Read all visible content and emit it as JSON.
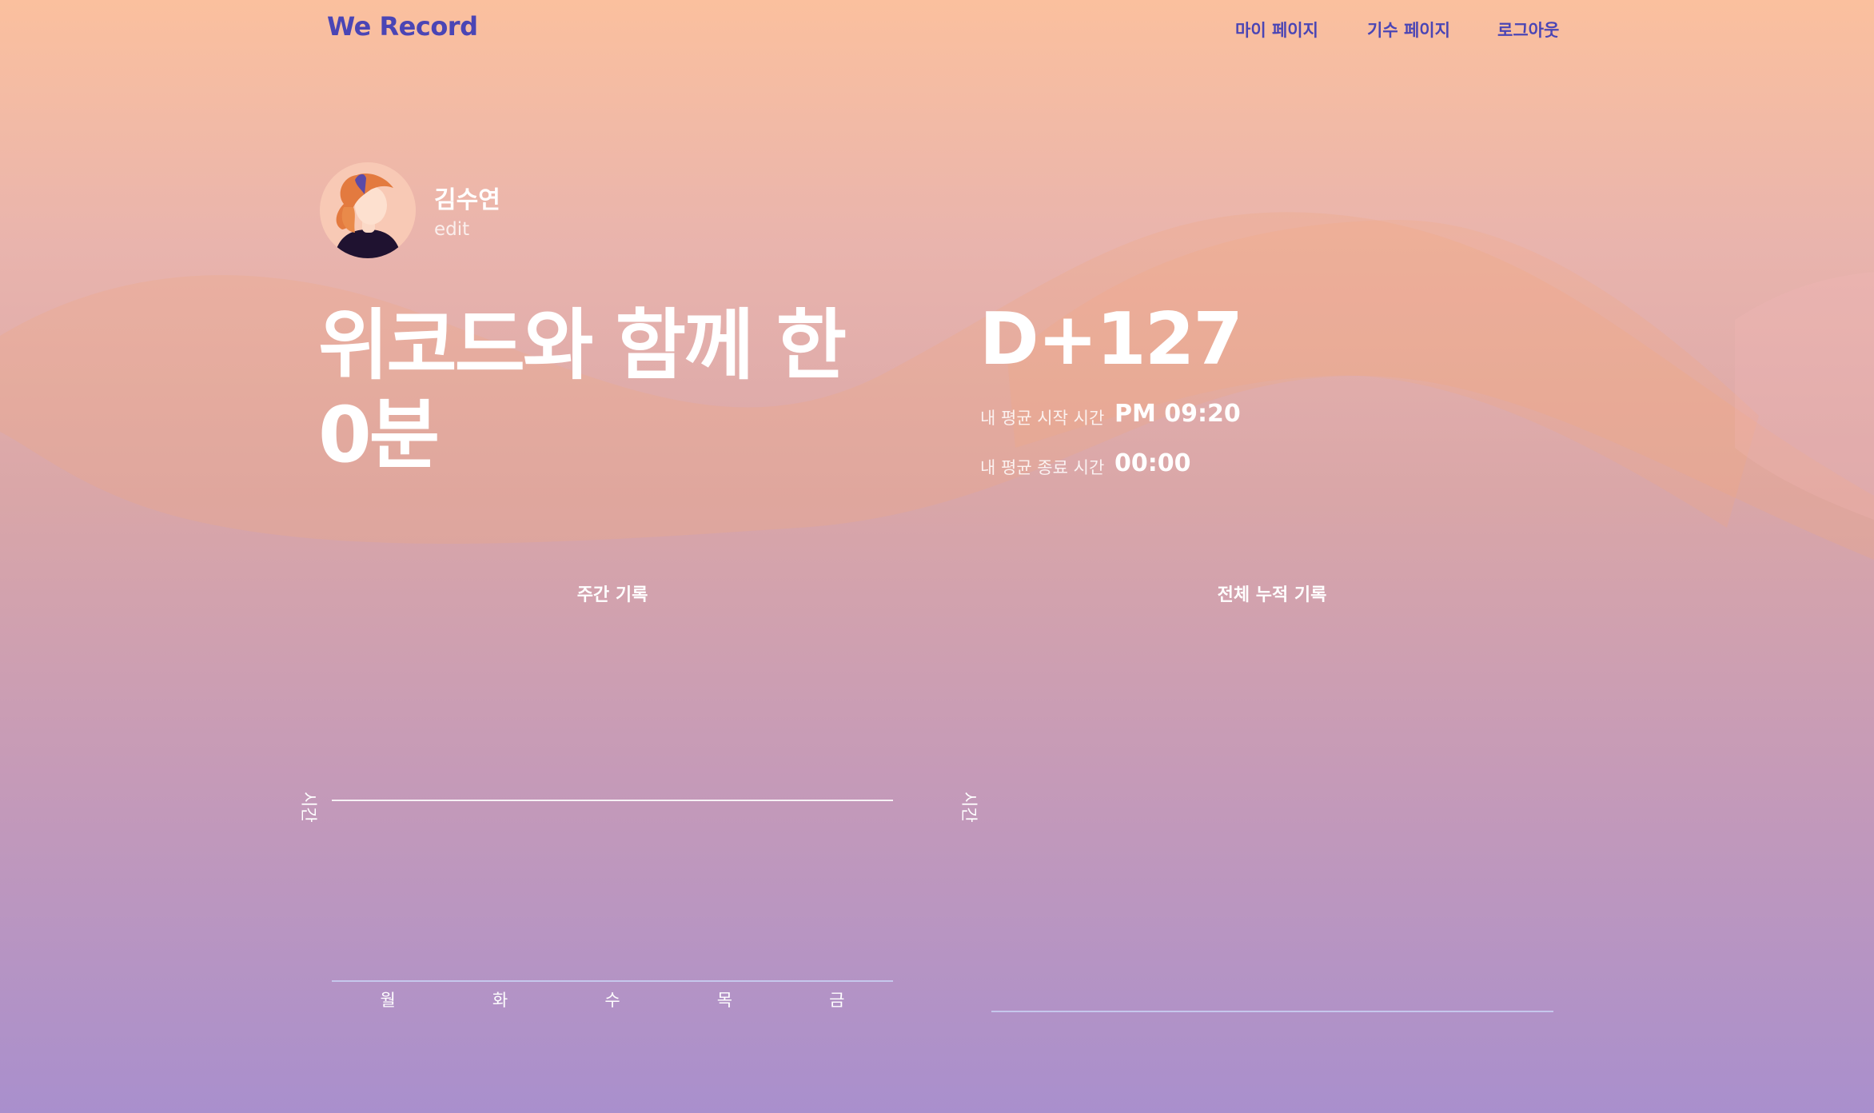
{
  "header": {
    "brand": "We Record",
    "nav": [
      "마이 페이지",
      "기수 페이지",
      "로그아웃"
    ]
  },
  "profile": {
    "name": "김수연",
    "edit_label": "edit"
  },
  "summary": {
    "headline_line1": "위코드와 함께 한",
    "headline_line2": "0분",
    "dday": "D+127",
    "avg_start_label": "내 평균 시작 시간",
    "avg_start_value": "PM 09:20",
    "avg_end_label": "내 평균 종료 시간",
    "avg_end_value": "00:00"
  },
  "colors": {
    "brand": "#4a45b5",
    "gradient_top": "#fbc09e",
    "gradient_bottom": "#a98fcd"
  },
  "charts": {
    "weekly": {
      "title": "주간 기록",
      "ylabel": "시간"
    },
    "total": {
      "title": "전체 누적 기록",
      "ylabel": "시간"
    }
  },
  "chart_data": [
    {
      "type": "bar",
      "title": "주간 기록",
      "ylabel": "시간",
      "categories": [
        "월",
        "화",
        "수",
        "목",
        "금"
      ],
      "values": [
        0,
        0,
        0,
        0,
        0
      ]
    },
    {
      "type": "line",
      "title": "전체 누적 기록",
      "ylabel": "시간",
      "categories": [],
      "values": []
    }
  ]
}
